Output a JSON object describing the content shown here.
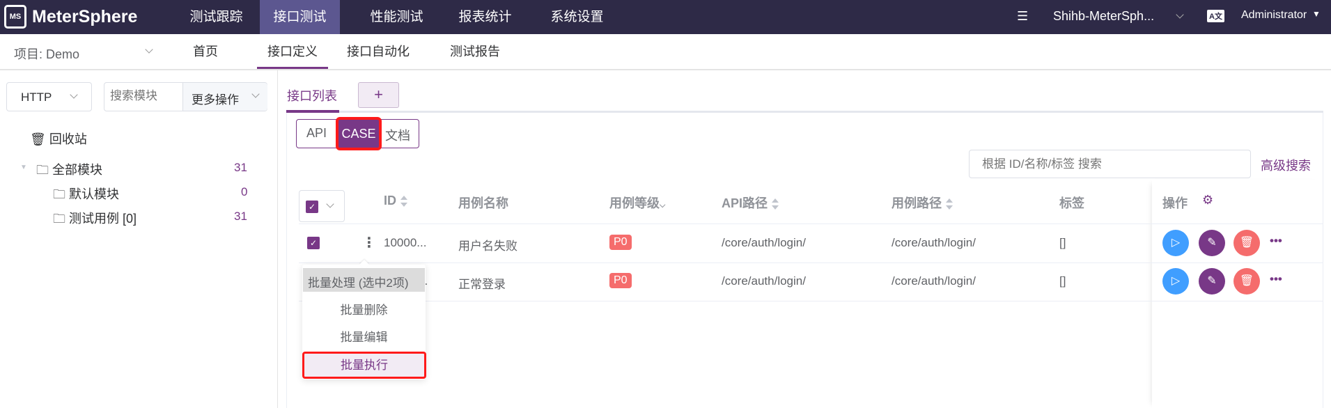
{
  "topnav": {
    "brand": "MeterSphere",
    "items": [
      "测试跟踪",
      "接口测试",
      "性能测试",
      "报表统计",
      "系统设置"
    ],
    "active": "接口测试",
    "workspace": "Shihb-MeterSph...",
    "user": "Administrator"
  },
  "subnav": {
    "project": "项目: Demo",
    "tabs": [
      "首页",
      "接口定义",
      "接口自动化",
      "测试报告"
    ],
    "active": "接口定义"
  },
  "left": {
    "protocol": "HTTP",
    "search_placeholder": "搜索模块",
    "more_ops": "更多操作",
    "recycle": "回收站",
    "tree": [
      {
        "label": "全部模块",
        "count": "31"
      },
      {
        "label": "默认模块",
        "count": "0"
      },
      {
        "label": "测试用例 [0]",
        "count": "31"
      }
    ]
  },
  "main": {
    "tab": "接口列表",
    "add": "+",
    "modes": [
      "API",
      "CASE",
      "文档"
    ],
    "active_mode": "CASE",
    "search_placeholder": "根据 ID/名称/标签 搜索",
    "advanced": "高级搜索",
    "columns": [
      "ID",
      "用例名称",
      "用例等级",
      "API路径",
      "用例路径",
      "标签",
      "操作"
    ],
    "rows": [
      {
        "id": "10000...",
        "name": "用户名失败",
        "level": "P0",
        "api_path": "/core/auth/login/",
        "case_path": "/core/auth/login/",
        "tags": "[]",
        "checked": true
      },
      {
        "id": "...",
        "name": "正常登录",
        "level": "P0",
        "api_path": "/core/auth/login/",
        "case_path": "/core/auth/login/",
        "tags": "[]",
        "checked": true
      }
    ],
    "batch_menu": {
      "header": "批量处理 (选中2项)",
      "items": [
        "批量删除",
        "批量编辑",
        "批量执行"
      ],
      "highlighted": "批量执行"
    }
  },
  "colors": {
    "nav": "#2e2a47",
    "accent": "#783887",
    "danger": "#f56c6c",
    "primary": "#409eff",
    "highlight": "#ff1a1a"
  }
}
